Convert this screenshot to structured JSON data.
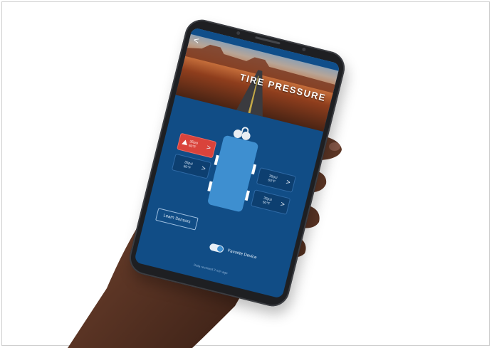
{
  "app": {
    "header": {
      "title": "TIRE PRESSURE",
      "back_glyph": "<"
    },
    "tires": [
      {
        "id": "front-left",
        "value": "35psi\n60°F",
        "status": "alert",
        "chevron": ">"
      },
      {
        "id": "rear-left",
        "value": "35psi\n60°F",
        "status": "normal",
        "chevron": ">"
      },
      {
        "id": "front-right",
        "value": "35psi\n60°F",
        "status": "normal",
        "chevron": ">"
      },
      {
        "id": "rear-right",
        "value": "35psi\n60°F",
        "status": "normal",
        "chevron": ">"
      }
    ],
    "learn_button_label": "Learn Sensors",
    "favorite_label": "Favorite Device",
    "favorite_on": true,
    "footer_note": "Data received 2 min ago"
  },
  "colors": {
    "screen_bg": "#114d86",
    "alert_red": "#d9433b",
    "truck_blue": "#3e8fd0",
    "phone_body": "#1e1f22",
    "skin": "#5a3424"
  },
  "icons": [
    "back-icon",
    "warning-icon",
    "chevron-right-icon",
    "toggle-switch",
    "truck-icon"
  ]
}
